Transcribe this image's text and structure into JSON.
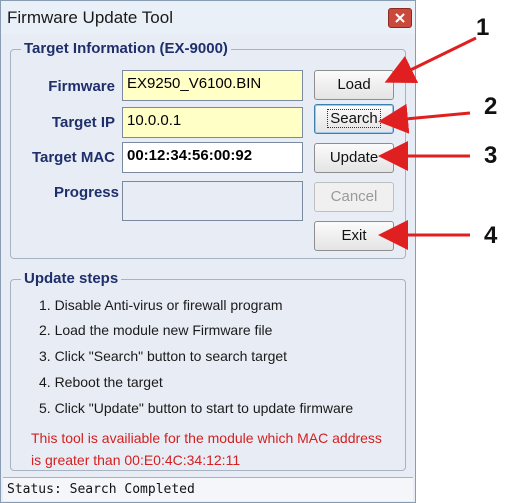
{
  "window": {
    "title": "Firmware Update Tool"
  },
  "target_info": {
    "legend": "Target Information (EX-9000)",
    "firmware_label": "Firmware",
    "firmware_value": "EX9250_V6100.BIN",
    "ip_label": "Target IP",
    "ip_value": "10.0.0.1",
    "mac_label": "Target MAC",
    "mac_value": "00:12:34:56:00:92",
    "progress_label": "Progress"
  },
  "buttons": {
    "load": "Load",
    "search": "Search",
    "update": "Update",
    "cancel": "Cancel",
    "exit": "Exit"
  },
  "update_steps": {
    "legend": "Update steps",
    "steps": [
      "1. Disable Anti-virus or firewall program",
      "2. Load the module new Firmware file",
      "3. Click \"Search\" button to search target",
      "4. Reboot the target",
      "5. Click \"Update\" button to start to update firmware"
    ],
    "note_line1": "This tool is availiable for the module which MAC address",
    "note_line2": "is greater than 00:E0:4C:34:12:11"
  },
  "status": {
    "text": "Status: Search Completed"
  },
  "callouts": [
    "1",
    "2",
    "3",
    "4"
  ],
  "colors": {
    "callout_arrow": "#e02020",
    "note_text": "#d42020",
    "label_text": "#1f2f6b"
  }
}
